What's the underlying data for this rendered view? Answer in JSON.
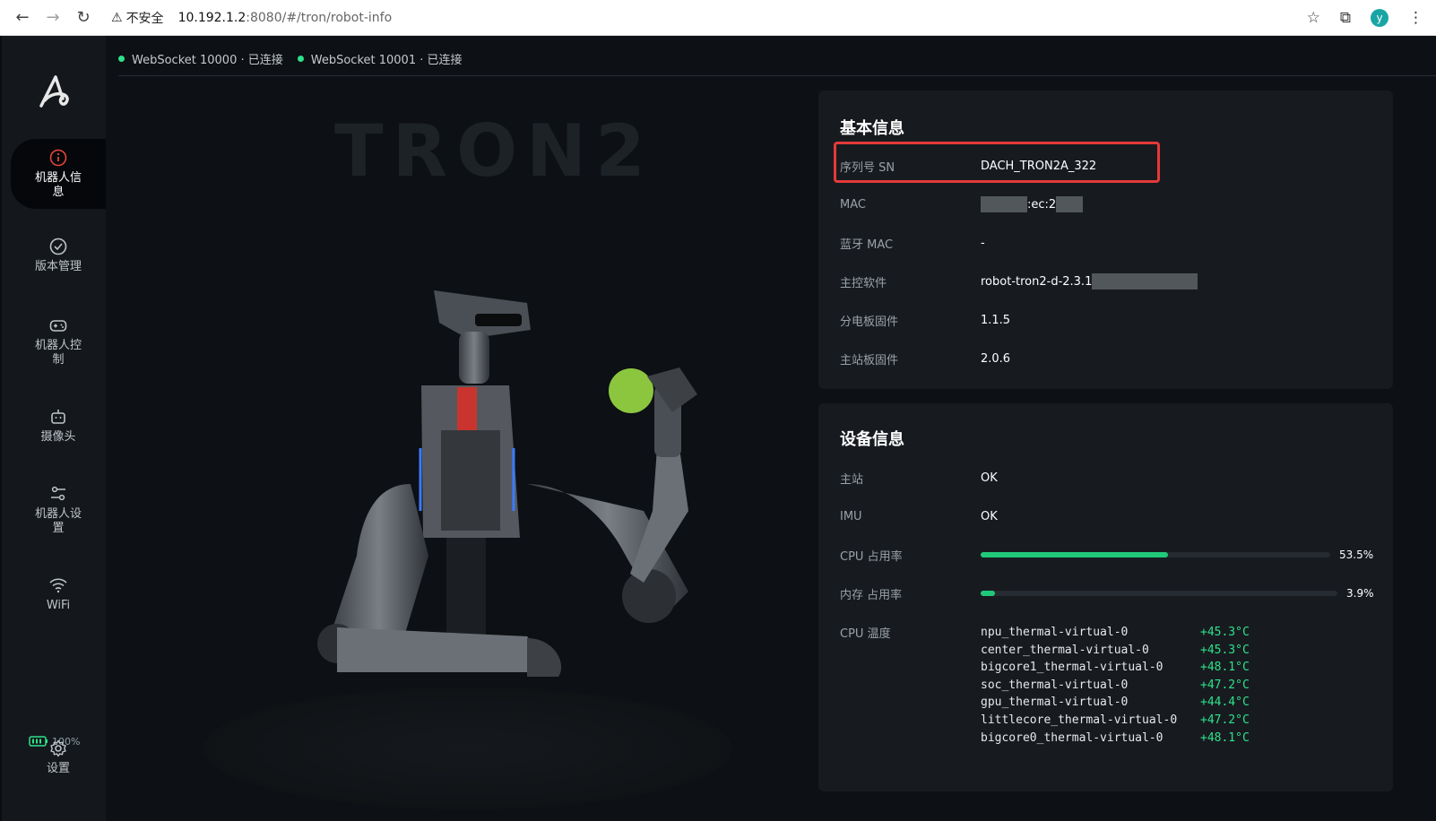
{
  "browser": {
    "security_label": "不安全",
    "url_host": "10.192.1.2",
    "url_rest": ":8080/#/tron/robot-info",
    "profile_initial": "y"
  },
  "sidebar": {
    "items": [
      {
        "label": "机器人信息",
        "icon": "info-circle-icon",
        "active": true
      },
      {
        "label": "版本管理",
        "icon": "check-circle-icon"
      },
      {
        "label": "机器人控制",
        "icon": "gamepad-icon"
      },
      {
        "label": "摄像头",
        "icon": "robot-camera-icon"
      },
      {
        "label": "机器人设置",
        "icon": "sliders-icon"
      },
      {
        "label": "WiFi",
        "icon": "wifi-icon"
      }
    ],
    "battery": "100%",
    "settings_label": "设置"
  },
  "status": {
    "ws1": "WebSocket 10000 · 已连接",
    "ws2": "WebSocket 10001 · 已连接"
  },
  "hero": {
    "wordmark": "TRON2"
  },
  "basic_info": {
    "title": "基本信息",
    "rows": [
      {
        "key": "序列号 SN",
        "value": "DACH_TRON2A_322"
      },
      {
        "key": "MAC",
        "value": ":ec:2"
      },
      {
        "key": "蓝牙 MAC",
        "value": "-"
      },
      {
        "key": "主控软件",
        "value": "robot-tron2-d-2.3.1"
      },
      {
        "key": "分电板固件",
        "value": "1.1.5"
      },
      {
        "key": "主站板固件",
        "value": "2.0.6"
      }
    ]
  },
  "device_info": {
    "title": "设备信息",
    "master": {
      "key": "主站",
      "value": "OK"
    },
    "imu": {
      "key": "IMU",
      "value": "OK"
    },
    "cpu": {
      "key": "CPU 占用率",
      "percent": 53.5,
      "label": "53.5%"
    },
    "mem": {
      "key": "内存 占用率",
      "percent": 3.9,
      "label": "3.9%"
    },
    "temp_key": "CPU 温度",
    "temps": [
      {
        "name": "npu_thermal-virtual-0",
        "value": "+45.3°C"
      },
      {
        "name": "center_thermal-virtual-0",
        "value": "+45.3°C"
      },
      {
        "name": "bigcore1_thermal-virtual-0",
        "value": "+48.1°C"
      },
      {
        "name": "soc_thermal-virtual-0",
        "value": "+47.2°C"
      },
      {
        "name": "gpu_thermal-virtual-0",
        "value": "+44.4°C"
      },
      {
        "name": "littlecore_thermal-virtual-0",
        "value": "+47.2°C"
      },
      {
        "name": "bigcore0_thermal-virtual-0",
        "value": "+48.1°C"
      }
    ]
  },
  "colors": {
    "accent": "#2ee28a",
    "highlight": "#e53939",
    "background": "#0d1014",
    "card": "#171b20"
  }
}
